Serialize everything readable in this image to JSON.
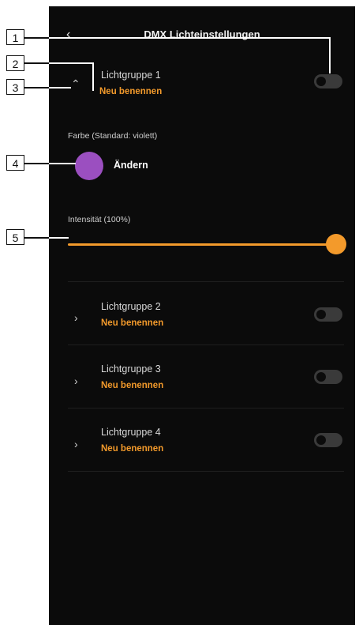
{
  "header": {
    "title": "DMX Lichteinstellungen",
    "back_icon": "chevron-left-icon"
  },
  "expanded_group": {
    "name": "Lichtgruppe 1",
    "rename_label": "Neu benennen",
    "chevron_icon": "chevron-up-icon",
    "toggle_on": false,
    "color_label": "Farbe (Standard: violett)",
    "color_value": "#9b4fc0",
    "change_label": "Ändern",
    "intensity_label": "Intensität (100%)",
    "intensity_value": 1.0
  },
  "groups": [
    {
      "name": "Lichtgruppe 2",
      "rename_label": "Neu benennen",
      "toggle_on": false
    },
    {
      "name": "Lichtgruppe 3",
      "rename_label": "Neu benennen",
      "toggle_on": false
    },
    {
      "name": "Lichtgruppe 4",
      "rename_label": "Neu benennen",
      "toggle_on": false
    }
  ],
  "callouts": [
    "1",
    "2",
    "3",
    "4",
    "5"
  ],
  "colors": {
    "accent": "#f39a2b",
    "background": "#0b0b0b"
  }
}
